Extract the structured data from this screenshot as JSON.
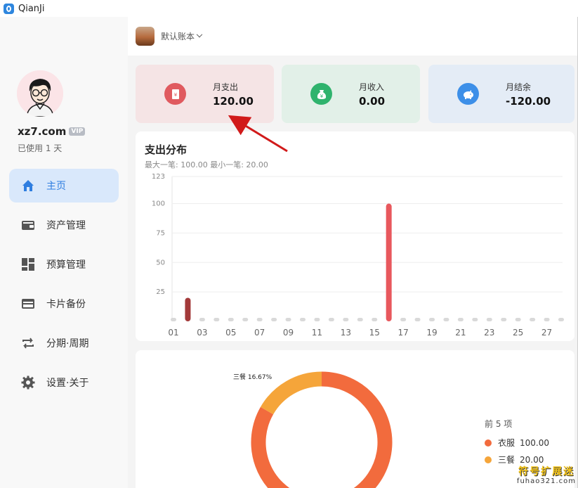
{
  "app": {
    "title": "QianJi"
  },
  "sidebar": {
    "username": "xz7.com",
    "vip_badge": "VIP",
    "used_days": "已使用 1 天",
    "items": [
      {
        "label": "主页",
        "icon": "home-icon",
        "active": true
      },
      {
        "label": "资产管理",
        "icon": "wallet-icon"
      },
      {
        "label": "预算管理",
        "icon": "dashboard-icon"
      },
      {
        "label": "卡片备份",
        "icon": "card-icon"
      },
      {
        "label": "分期·周期",
        "icon": "repeat-icon"
      },
      {
        "label": "设置·关于",
        "icon": "gear-icon"
      }
    ]
  },
  "topbar": {
    "book_name": "默认账本"
  },
  "summary": [
    {
      "label": "月支出",
      "value": "120.00",
      "icon": "receipt-icon",
      "bg": "#f5e4e5",
      "icon_color": "#e05a5f"
    },
    {
      "label": "月收入",
      "value": "0.00",
      "icon": "money-bag-icon",
      "bg": "#e2f0e8",
      "icon_color": "#2fb36d"
    },
    {
      "label": "月结余",
      "value": "-120.00",
      "icon": "piggy-bank-icon",
      "bg": "#e4ecf6",
      "icon_color": "#3d8fe8"
    }
  ],
  "expense_chart": {
    "title": "支出分布",
    "subtitle": "最大一笔: 100.00 最小一笔: 20.00"
  },
  "chart_data": [
    {
      "type": "bar",
      "y_ticks": [
        "123",
        "100",
        "75",
        "50",
        "25"
      ],
      "ylim": [
        0,
        123
      ],
      "x_tick_labels": [
        "01",
        "03",
        "05",
        "07",
        "09",
        "11",
        "13",
        "15",
        "17",
        "19",
        "21",
        "23",
        "25",
        "27"
      ],
      "categories": [
        1,
        2,
        3,
        4,
        5,
        6,
        7,
        8,
        9,
        10,
        11,
        12,
        13,
        14,
        15,
        16,
        17,
        18,
        19,
        20,
        21,
        22,
        23,
        24,
        25,
        26,
        27,
        28
      ],
      "values": [
        0,
        20,
        0,
        0,
        0,
        0,
        0,
        0,
        0,
        0,
        0,
        0,
        0,
        0,
        0,
        100,
        0,
        0,
        0,
        0,
        0,
        0,
        0,
        0,
        0,
        0,
        0,
        0
      ],
      "bar_colors": {
        "2": "#a33a3a",
        "16": "#e8585d"
      },
      "empty_color": "#d9d9d9"
    },
    {
      "type": "pie",
      "legend_title": "前 5 项",
      "slice_label": "三餐 16.67%",
      "slices": [
        {
          "name": "衣服",
          "value": "100.00",
          "color": "#f26b3d"
        },
        {
          "name": "三餐",
          "value": "20.00",
          "color": "#f5a53a"
        }
      ]
    }
  ],
  "watermark": {
    "line1": "符号扩展迷",
    "line2": "fuhao321.com"
  }
}
